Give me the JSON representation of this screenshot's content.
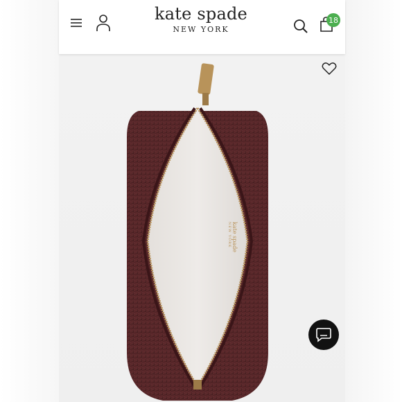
{
  "header": {
    "brand_name": "kate spade",
    "brand_sub": "NEW YORK",
    "bag_count": "18"
  },
  "icons": {
    "menu": "menu-icon",
    "account": "account-icon",
    "search": "search-icon",
    "bag": "shopping-bag-icon",
    "wishlist": "heart-icon",
    "chat": "chat-icon"
  },
  "product": {
    "logo_text_line1": "kate spade",
    "logo_text_line2": "NEW YORK"
  },
  "colors": {
    "badge_green": "#4caf50",
    "pouch_burgundy": "#5a2a2a",
    "zipper_gold": "#b8935a"
  }
}
